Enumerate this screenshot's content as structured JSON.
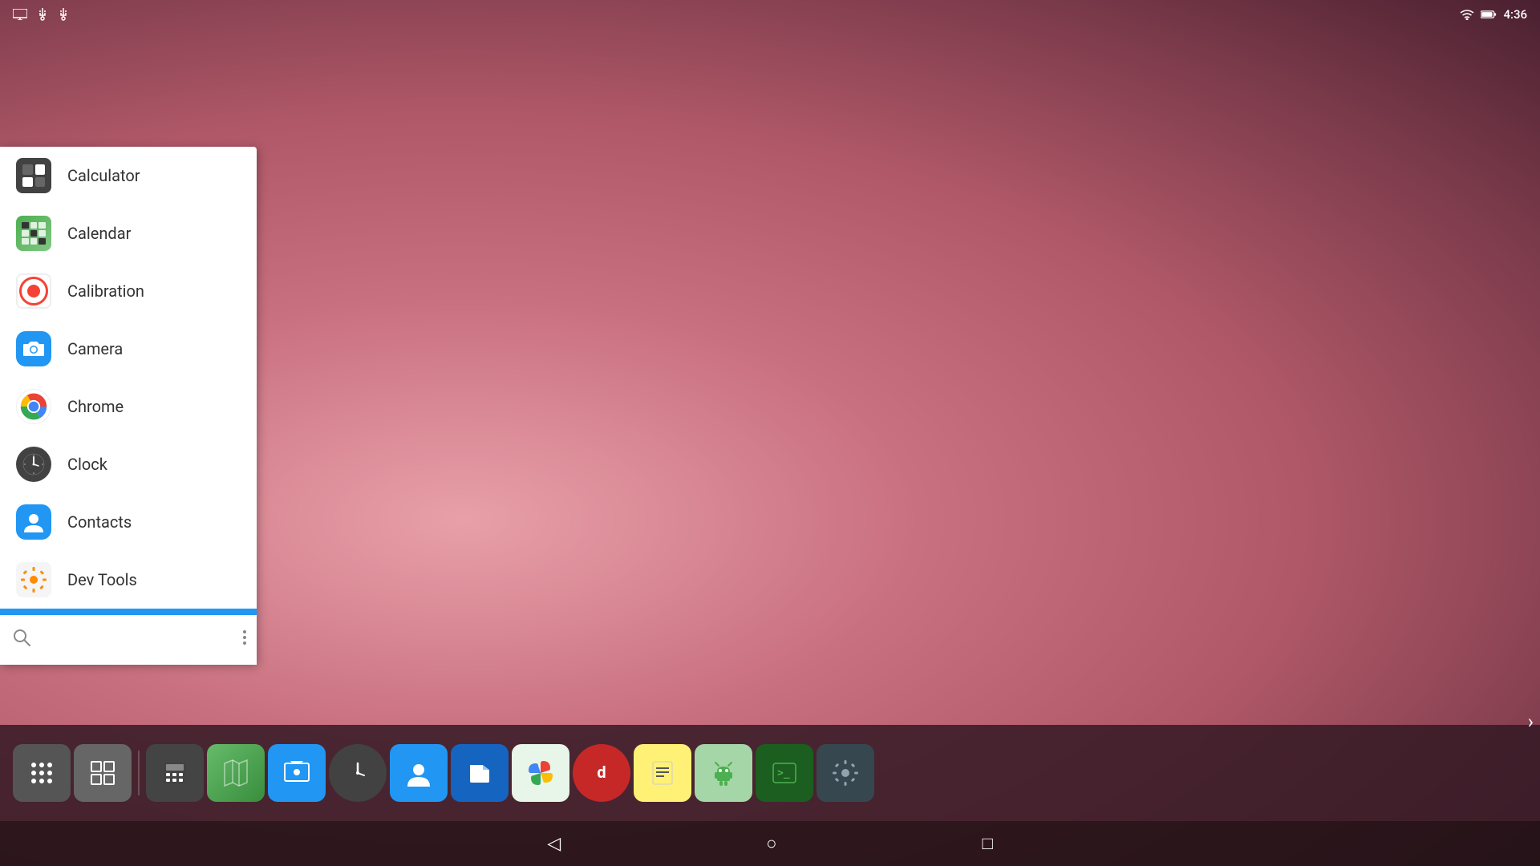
{
  "statusBar": {
    "time": "4:36",
    "icons": [
      "display",
      "usb",
      "usb2",
      "wifi",
      "battery"
    ]
  },
  "appDrawer": {
    "apps": [
      {
        "id": "calculator",
        "label": "Calculator",
        "icon": "calculator"
      },
      {
        "id": "calendar",
        "label": "Calendar",
        "icon": "calendar"
      },
      {
        "id": "calibration",
        "label": "Calibration",
        "icon": "calibration"
      },
      {
        "id": "camera",
        "label": "Camera",
        "icon": "camera"
      },
      {
        "id": "chrome",
        "label": "Chrome",
        "icon": "chrome"
      },
      {
        "id": "clock",
        "label": "Clock",
        "icon": "clock"
      },
      {
        "id": "contacts",
        "label": "Contacts",
        "icon": "contacts"
      },
      {
        "id": "devtools",
        "label": "Dev Tools",
        "icon": "devtools"
      }
    ],
    "search": {
      "placeholder": "",
      "currentValue": ""
    }
  },
  "taskbar": {
    "apps": [
      {
        "id": "apps-grid",
        "label": "All Apps"
      },
      {
        "id": "grid-view",
        "label": "Grid"
      },
      {
        "id": "calculator",
        "label": "Calculator"
      },
      {
        "id": "maps",
        "label": "Maps"
      },
      {
        "id": "screenshot",
        "label": "Screenshot"
      },
      {
        "id": "clock",
        "label": "Clock"
      },
      {
        "id": "contacts",
        "label": "Contacts"
      },
      {
        "id": "files",
        "label": "Files"
      },
      {
        "id": "photos",
        "label": "Photos"
      },
      {
        "id": "music",
        "label": "Music"
      },
      {
        "id": "notes",
        "label": "Notes"
      },
      {
        "id": "android-head",
        "label": "Android"
      },
      {
        "id": "terminal",
        "label": "Terminal"
      },
      {
        "id": "settings",
        "label": "Settings"
      }
    ]
  },
  "navBar": {
    "back": "◁",
    "home": "○",
    "recent": "□"
  }
}
